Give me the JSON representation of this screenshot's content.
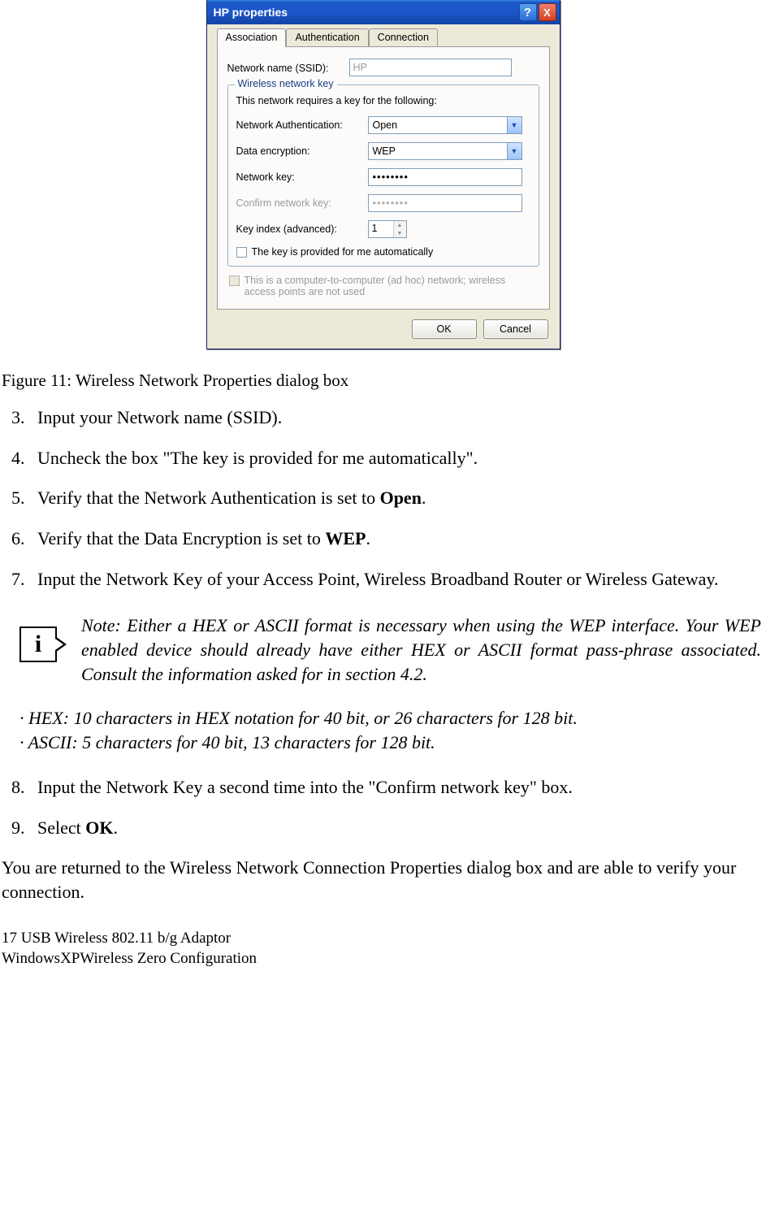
{
  "dialog": {
    "title": "HP properties",
    "tabs": [
      "Association",
      "Authentication",
      "Connection"
    ],
    "active_tab": 0,
    "ssid_label": "Network name (SSID):",
    "ssid_value": "HP",
    "group_title": "Wireless network key",
    "group_intro": "This network requires a key for the following:",
    "auth_label": "Network Authentication:",
    "auth_value": "Open",
    "enc_label": "Data encryption:",
    "enc_value": "WEP",
    "key_label": "Network key:",
    "key_value": "••••••••",
    "confirm_label": "Confirm network key:",
    "confirm_value": "••••••••",
    "index_label": "Key index (advanced):",
    "index_value": "1",
    "auto_key_label": "The key is provided for me automatically",
    "adhoc_label": "This is a computer-to-computer (ad hoc) network; wireless access points are not used",
    "ok": "OK",
    "cancel": "Cancel"
  },
  "caption": "Figure 11: Wireless Network Properties dialog box",
  "steps_a": {
    "s3": "Input your Network name (SSID).",
    "s4": "Uncheck the box \"The key is provided for me automatically\".",
    "s5_pre": "Verify that the Network Authentication is set to ",
    "s5_b": "Open",
    "s5_post": ".",
    "s6_pre": "Verify that the Data Encryption is set to ",
    "s6_b": "WEP",
    "s6_post": ".",
    "s7": "Input the Network Key of your Access Point, Wireless Broadband Router or Wireless Gateway."
  },
  "note": "Note: Either a HEX or ASCII format is necessary when using the WEP interface. Your WEP enabled device should already have either HEX or ASCII format pass-phrase associated. Consult the information asked for in section 4.2.",
  "bullets": {
    "b1": "· HEX: 10 characters in HEX notation for 40 bit, or 26 characters for 128 bit.",
    "b2": "· ASCII: 5 characters for 40 bit, 13 characters for 128 bit."
  },
  "steps_b": {
    "s8": "Input the Network Key a second time into the \"Confirm network key\" box.",
    "s9_pre": "Select ",
    "s9_b": "OK",
    "s9_post": "."
  },
  "closing": "You are returned to the Wireless Network Connection Properties dialog box and are able to verify your connection.",
  "footer": {
    "l1": "17     USB Wireless 802.11 b/g Adaptor",
    "l2": "WindowsXPWireless Zero Configuration"
  },
  "glyphs": {
    "help": "?",
    "close": "X",
    "chev": "▼",
    "up": "▲",
    "down": "▼",
    "info": "i"
  }
}
